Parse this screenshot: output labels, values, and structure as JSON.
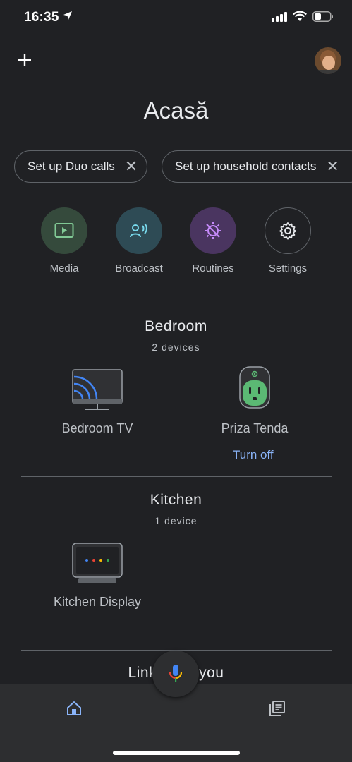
{
  "status_bar": {
    "time": "16:35"
  },
  "header": {
    "title": "Acasă"
  },
  "chips": [
    {
      "label": "Set up Duo calls"
    },
    {
      "label": "Set up household contacts"
    }
  ],
  "actions": [
    {
      "label": "Media",
      "color": "#354a3c",
      "icon": "media-icon"
    },
    {
      "label": "Broadcast",
      "color": "#2e4b55",
      "icon": "broadcast-icon"
    },
    {
      "label": "Routines",
      "color": "#4a3560",
      "icon": "routines-icon"
    },
    {
      "label": "Settings",
      "color": "#202124",
      "icon": "gear-icon"
    }
  ],
  "rooms": [
    {
      "name": "Bedroom",
      "count": "2 devices",
      "devices": [
        {
          "name": "Bedroom TV",
          "icon": "tv-icon"
        },
        {
          "name": "Priza Tenda",
          "icon": "smart-plug-icon",
          "action": "Turn off"
        }
      ]
    },
    {
      "name": "Kitchen",
      "count": "1 device",
      "devices": [
        {
          "name": "Kitchen Display",
          "icon": "smart-display-icon"
        }
      ]
    }
  ],
  "linked_section": {
    "title_left": "Link",
    "title_right": "you"
  },
  "bottom_nav": [
    {
      "icon": "home-icon",
      "active": true,
      "color": "#8ab4f8"
    },
    {
      "icon": "feed-icon",
      "active": false
    }
  ],
  "colors": {
    "accent": "#8ab4f8",
    "background": "#202124",
    "plug_green": "#5bb974"
  }
}
